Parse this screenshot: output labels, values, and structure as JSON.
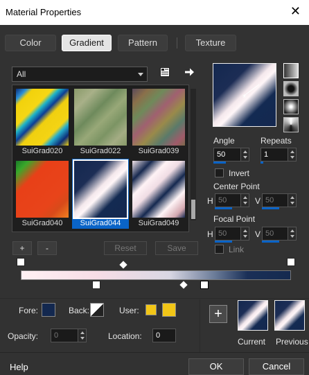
{
  "window": {
    "title": "Material Properties",
    "close_glyph": "✕"
  },
  "tabs": [
    {
      "label": "Color",
      "active": false
    },
    {
      "label": "Gradient",
      "active": true
    },
    {
      "label": "Pattern",
      "active": false
    },
    {
      "label": "Texture",
      "active": false
    }
  ],
  "library": {
    "category": "All",
    "items": [
      {
        "label": "SuiGrad020",
        "selected": false,
        "gradient": "linear-gradient(135deg,#0c2d78 0%,#2b8fd8 10%,#f2d20c 16%,#f6d714 34%,#1fb4c7 40%,#0d3d96 48%,#f0d010 56%,#f4d414 74%,#28b0cc 80%,#0c2d78 90%,#f0cf10 100%)"
      },
      {
        "label": "SuiGrad022",
        "selected": false,
        "gradient": "linear-gradient(135deg,#8a9a6a 0%,#a8b088 20%,#6e8a5c 40%,#98a878 55%,#7c9464 70%,#a4ac84 85%,#879a68 100%)"
      },
      {
        "label": "SuiGrad039",
        "selected": false,
        "gradient": "linear-gradient(135deg,#5b4a5a 0%,#8a6f4a 15%,#6f8a5a 30%,#a06070 45%,#9a8a4a 60%,#5a7a6a 75%,#a05a6a 90%,#7a6a4a 100%)"
      },
      {
        "label": "SuiGrad040",
        "selected": false,
        "gradient": "linear-gradient(135deg,#1a7a2a 0%,#3aa82a 12%,#e84018 30%,#e8441a 70%,#d84a1a 82%,#f08020 100%)"
      },
      {
        "label": "SuiGrad044",
        "selected": true,
        "gradient": "linear-gradient(135deg,#14284f 0%,#1c2d55 30%,#f4e8ec 48%,#fff6f8 55%,#132a52 72%,#14284f 100%)"
      },
      {
        "label": "SuiGrad049",
        "selected": false,
        "gradient": "linear-gradient(135deg,#f4e6ea 0%,#17294f 18%,#fff2f5 32%,#f0dde4 45%,#14284f 60%,#fff4f6 75%,#d4a8b0 90%,#14284f 100%)"
      }
    ]
  },
  "list_buttons": {
    "add": "+",
    "remove": "-",
    "reset": "Reset",
    "save": "Save"
  },
  "settings": {
    "angle_label": "Angle",
    "angle_value": "50",
    "repeats_label": "Repeats",
    "repeats_value": "1",
    "invert_label": "Invert",
    "center_point_label": "Center Point",
    "center_h_label": "H",
    "center_h_value": "50",
    "center_v_label": "V",
    "center_v_value": "50",
    "focal_point_label": "Focal Point",
    "focal_h_label": "H",
    "focal_h_value": "50",
    "focal_v_label": "V",
    "focal_v_value": "50",
    "link_label": "Link"
  },
  "colors": {
    "fore_label": "Fore:",
    "back_label": "Back:",
    "user_label": "User:",
    "user_color": "#f2c617",
    "fore_color": "#13284f",
    "accent": "#0a64c8"
  },
  "opacity": {
    "label": "Opacity:",
    "value": "0"
  },
  "location": {
    "label": "Location:",
    "value": "0"
  },
  "swatches": {
    "current_label": "Current",
    "previous_label": "Previous",
    "add_glyph": "+"
  },
  "footer": {
    "help": "Help",
    "ok": "OK",
    "cancel": "Cancel"
  }
}
